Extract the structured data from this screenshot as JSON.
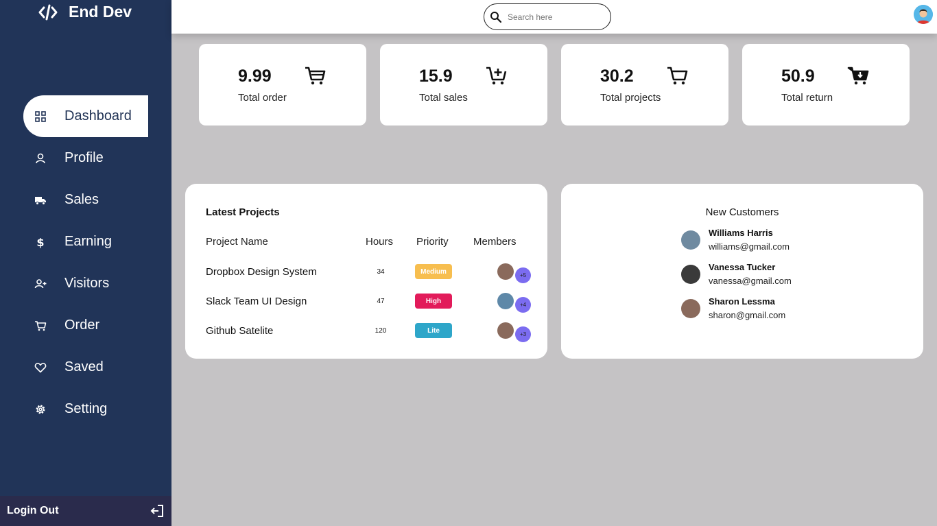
{
  "brand": {
    "name": "End Dev"
  },
  "nav": [
    {
      "label": "Dashboard",
      "icon": "grid-icon"
    },
    {
      "label": "Profile",
      "icon": "user-icon"
    },
    {
      "label": "Sales",
      "icon": "truck-icon"
    },
    {
      "label": "Earning",
      "icon": "dollar-icon"
    },
    {
      "label": "Visitors",
      "icon": "user-plus-icon"
    },
    {
      "label": "Order",
      "icon": "cart-icon"
    },
    {
      "label": "Saved",
      "icon": "heart-icon"
    },
    {
      "label": "Setting",
      "icon": "gear-icon"
    }
  ],
  "logout": {
    "label": "Login Out"
  },
  "search": {
    "placeholder": "Search here"
  },
  "stats": [
    {
      "value": "9.99",
      "label": "Total order",
      "icon": "cart-icon"
    },
    {
      "value": "15.9",
      "label": "Total sales",
      "icon": "cart-plus-icon"
    },
    {
      "value": "30.2",
      "label": "Total projects",
      "icon": "cart-icon"
    },
    {
      "value": "50.9",
      "label": "Total return",
      "icon": "cart-down-icon"
    }
  ],
  "projects": {
    "title": "Latest Projects",
    "headers": {
      "name": "Project Name",
      "hours": "Hours",
      "priority": "Priority",
      "members": "Members"
    },
    "rows": [
      {
        "name": "Dropbox Design System",
        "hours": "34",
        "priority": "Medium",
        "priority_color": "#f7be4f",
        "extra": "+5"
      },
      {
        "name": "Slack Team UI Design",
        "hours": "47",
        "priority": "High",
        "priority_color": "#e21b5a",
        "extra": "+4"
      },
      {
        "name": "Github Satelite",
        "hours": "120",
        "priority": "Lite",
        "priority_color": "#2ea6c9",
        "extra": "+3"
      }
    ]
  },
  "customers": {
    "title": "New Customers",
    "list": [
      {
        "name": "Williams Harris",
        "email": "williams@gmail.com"
      },
      {
        "name": "Vanessa Tucker",
        "email": "vanessa@gmail.com"
      },
      {
        "name": "Sharon Lessma",
        "email": "sharon@gmail.com"
      }
    ]
  },
  "colors": {
    "sidebar": "#213458",
    "background": "#c5c3c5",
    "member_badge": "#7b6cf0"
  }
}
